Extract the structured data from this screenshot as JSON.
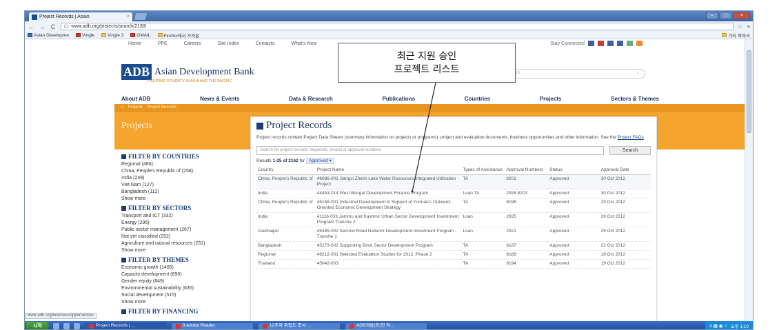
{
  "browser": {
    "tab_title": "Project Records | Asian",
    "tab_close": "×",
    "url": "www.adb.org/projects/search/2130!",
    "bookmarks": [
      {
        "label": "Asian Developme",
        "icon": "blue"
      },
      {
        "label": "Vingle",
        "icon": "red"
      },
      {
        "label": "Vingle 3",
        "icon": "folder"
      },
      {
        "label": "GMAIL",
        "icon": "red"
      },
      {
        "label": "Firefox에서 가져온",
        "icon": "folder"
      }
    ],
    "bookmarks_right": "기타 북마크",
    "status_url": "www.adb.org/business/opportunities"
  },
  "site": {
    "util_links": [
      "Home",
      "PPE",
      "Careers",
      "Site Index",
      "Contacts",
      "What's New"
    ],
    "util_right": "Stay Connected",
    "logo_abbrev": "ADB",
    "logo_name": "Asian Development Bank",
    "logo_tagline": "FIGHTING POVERTY IN ASIA AND THE PACIFIC",
    "search_placeholder": "Search",
    "main_nav": [
      "About ADB",
      "News & Events",
      "Data & Research",
      "Publications",
      "Countries",
      "Projects",
      "Sectors & Themes"
    ],
    "breadcrumb": [
      "Projects",
      "Project Records"
    ],
    "section_title": "Projects"
  },
  "filters": [
    {
      "title": "FILTER BY COUNTRIES",
      "items": [
        "Regional (486)",
        "China, People's Republic of (258)",
        "India (249)",
        "Viet Nam (127)",
        "Bangladesh (112)",
        "Show more"
      ]
    },
    {
      "title": "FILTER BY SECTORS",
      "items": [
        "Transport and ICT (332)",
        "Energy (296)",
        "Public sector management (267)",
        "Not yet classified (252)",
        "Agriculture and natural resources (231)",
        "Show more"
      ]
    },
    {
      "title": "FILTER BY THEMES",
      "items": [
        "Economic growth (1405)",
        "Capacity development (890)",
        "Gender equity (849)",
        "Environmental sustainability (635)",
        "Social development (515)",
        "Show more"
      ]
    },
    {
      "title": "FILTER BY FINANCING",
      "items": []
    }
  ],
  "records": {
    "title": "Project Records",
    "description": "Project records contain Project Data Sheets (summary information on projects or programs), project and evaluation documents, business opportunities and other information. See the",
    "description_link": "Project FAQs",
    "search_placeholder": "Search for project records: keywords, project or approval numbers",
    "search_button": "Search",
    "results_prefix": "Results",
    "results_range": "1-25 of 2162",
    "results_for": "for",
    "results_filter": "Approved",
    "columns": [
      "Country",
      "Project Name",
      "Types of Assistance",
      "Approval Numbers",
      "Status",
      "Approval Date"
    ],
    "rows": [
      {
        "country": "China, People's Republic of",
        "project": "46086-001 Jiangxi Zhelin Lake Water Resources Integrated Utilization Project",
        "type": "TA",
        "approval": "8201",
        "status": "Approved",
        "date": "30 Oct 2012"
      },
      {
        "country": "India",
        "project": "44453-014 West Bengal Development Finance Program",
        "type": "Loan TA",
        "approval": "2926 8203",
        "status": "Approved",
        "date": "30 Oct 2012"
      },
      {
        "country": "China, People's Republic of",
        "project": "45158-001 Industrial Development in Support of Yunnan's Outward-Oriented Economic Development Strategy",
        "type": "TA",
        "approval": "8196",
        "status": "Approved",
        "date": "29 Oct 2012"
      },
      {
        "country": "India",
        "project": "41116-033 Jammu and Kashmir Urban Sector Development Investment Program Tranche 2",
        "type": "Loan",
        "approval": "2925",
        "status": "Approved",
        "date": "26 Oct 2012"
      },
      {
        "country": "Azerbaijan",
        "project": "45385-002 Second Road Network Development Investment Program - Tranche 1",
        "type": "Loan",
        "approval": "2921",
        "status": "Approved",
        "date": "25 Oct 2012"
      },
      {
        "country": "Bangladesh",
        "project": "45273-002 Supporting Brick Sector Development Program",
        "type": "TA",
        "approval": "8187",
        "status": "Approved",
        "date": "22 Oct 2012"
      },
      {
        "country": "Regional",
        "project": "46212-001 Selected Evaluation Studies for 2012, Phase 2",
        "type": "TA",
        "approval": "8189",
        "status": "Approved",
        "date": "19 Oct 2012"
      },
      {
        "country": "Thailand",
        "project": "45042-003",
        "type": "TA",
        "approval": "8194",
        "status": "Approved",
        "date": "19 Oct 2012"
      }
    ]
  },
  "callout": {
    "line1": "최근 지원 승인",
    "line2": "프로젝트 리스트"
  },
  "taskbar": {
    "start": "시작",
    "tasks": [
      "Project Records | ...",
      "3 Adobe Reader",
      "12주차 위험도 조사 ...",
      "ADB개발(전)안 자..."
    ],
    "clock": "오후 1:10"
  },
  "colors": {
    "adb_blue": "#1a4d8f",
    "orange": "#f5a52e",
    "taskbar": "#214c98"
  }
}
